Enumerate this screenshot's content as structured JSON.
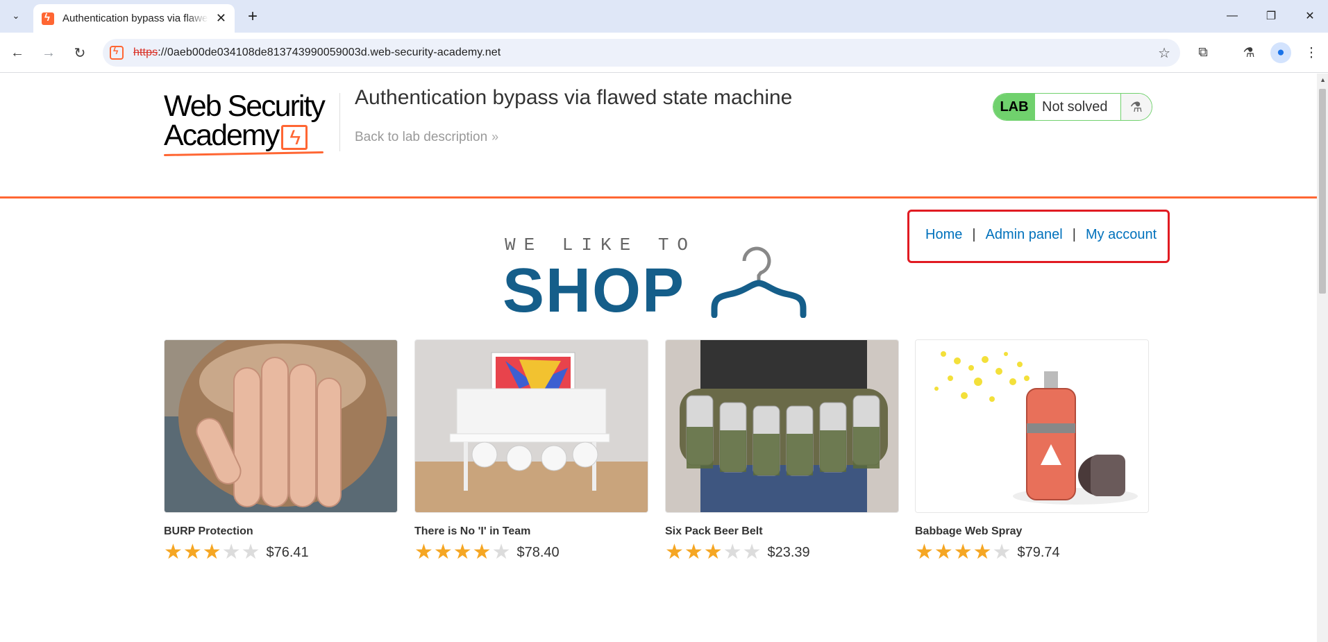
{
  "browser": {
    "tab_title": "Authentication bypass via flawed state machine",
    "url_scheme": "https",
    "url_rest": "://0aeb00de034108de813743990059003d.web-security-academy.net",
    "icons": [
      "tab-search-icon",
      "close-icon",
      "plus-icon",
      "minimize-icon",
      "restore-icon",
      "close-window-icon",
      "back-icon",
      "forward-icon",
      "reload-icon",
      "star-icon",
      "extensions-icon",
      "labs-icon",
      "profile-icon",
      "menu-icon"
    ]
  },
  "header": {
    "logo_line1": "Web Security",
    "logo_line2": "Academy",
    "lab_title": "Authentication bypass via flawed state machine",
    "back_link": "Back to lab description",
    "lab_badge": "LAB",
    "lab_status": "Not solved"
  },
  "nav": {
    "home": "Home",
    "separator": "|",
    "admin_panel": "Admin panel",
    "my_account": "My account"
  },
  "banner": {
    "small": "WE LIKE TO",
    "big": "SHOP"
  },
  "products": [
    {
      "name": "BURP Protection",
      "rating": 3,
      "price": "$76.41"
    },
    {
      "name": "There is No 'I' in Team",
      "rating": 4,
      "price": "$78.40"
    },
    {
      "name": "Six Pack Beer Belt",
      "rating": 3,
      "price": "$23.39"
    },
    {
      "name": "Babbage Web Spray",
      "rating": 4,
      "price": "$79.74"
    }
  ],
  "colors": {
    "accent": "#ff6633",
    "link": "#0071bc",
    "lab_green": "#70d16d",
    "shop_blue": "#155e8a",
    "highlight_red": "#e11b22",
    "star": "#f5a623"
  }
}
